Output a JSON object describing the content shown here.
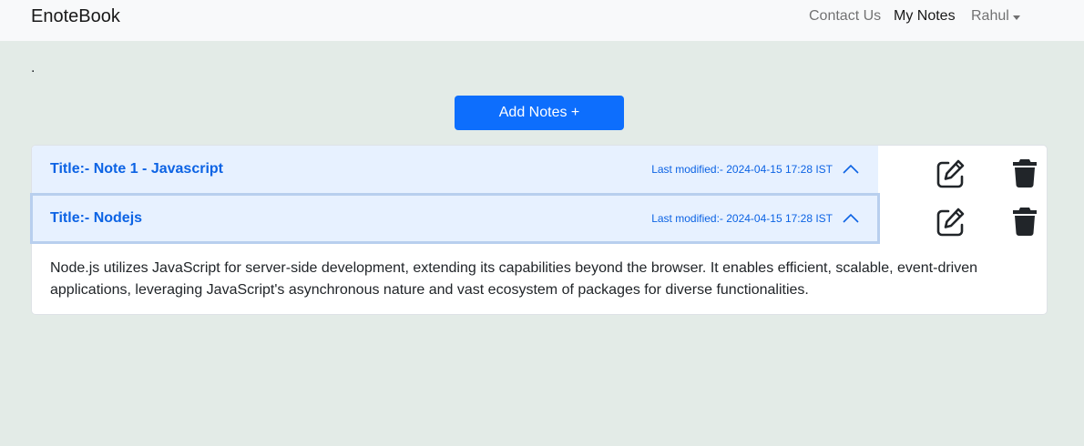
{
  "navbar": {
    "brand": "EnoteBook",
    "links": {
      "contact": "Contact Us",
      "my_notes": "My Notes",
      "user": "Rahul"
    }
  },
  "page": {
    "dot": "."
  },
  "add_button": {
    "label": "Add Notes +"
  },
  "notes": [
    {
      "title": "Title:- Note 1 - Javascript",
      "last_modified": "Last modified:- 2024-04-15 17:28 IST",
      "expanded": false
    },
    {
      "title": "Title:- Nodejs",
      "last_modified": "Last modified:- 2024-04-15 17:28 IST",
      "expanded": true,
      "body": "Node.js utilizes JavaScript for server-side development, extending its capabilities beyond the browser. It enables efficient, scalable, event-driven applications, leveraging JavaScript's asynchronous nature and vast ecosystem of packages for diverse functionalities."
    }
  ],
  "icons": {
    "edit": "edit-icon",
    "delete": "trash-icon",
    "chevron": "chevron-up-icon",
    "caret": "caret-down-icon"
  },
  "colors": {
    "accent": "#0d6efd",
    "accordion_active_bg": "#e7f1ff",
    "accordion_active_text": "#0c63e4",
    "page_bg": "#e3ebe7"
  }
}
